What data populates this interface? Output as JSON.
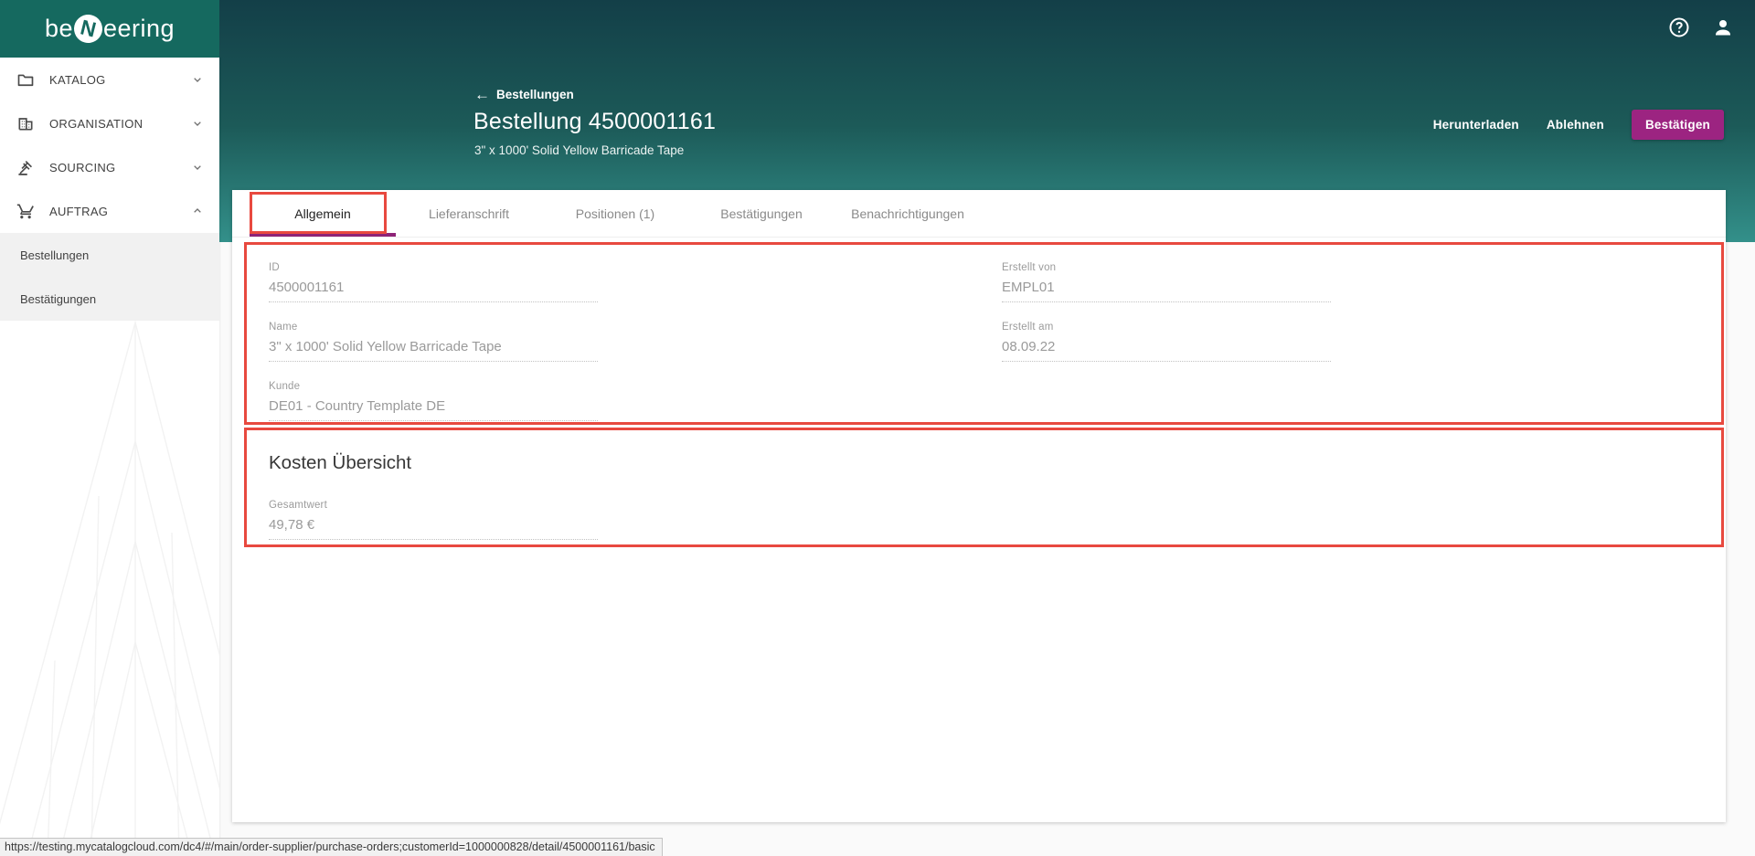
{
  "brand": {
    "prefix": "be",
    "mark": "N",
    "suffix": "eering"
  },
  "topbar": {
    "icons": [
      "help-icon",
      "account-icon"
    ]
  },
  "sidebar": {
    "items": [
      {
        "label": "KATALOG",
        "icon": "folder",
        "expanded": false
      },
      {
        "label": "ORGANISATION",
        "icon": "building",
        "expanded": false
      },
      {
        "label": "SOURCING",
        "icon": "gavel",
        "expanded": false
      },
      {
        "label": "AUFTRAG",
        "icon": "cart",
        "expanded": true
      }
    ],
    "subitems": [
      {
        "label": "Bestellungen",
        "active": true
      },
      {
        "label": "Bestätigungen",
        "active": false
      }
    ]
  },
  "header": {
    "breadcrumb": "Bestellungen",
    "title": "Bestellung 4500001161",
    "subtitle": "3\" x 1000' Solid Yellow Barricade Tape",
    "buttons": [
      {
        "label": "Herunterladen",
        "style": "text"
      },
      {
        "label": "Ablehnen",
        "style": "text"
      },
      {
        "label": "Bestätigen",
        "style": "filled"
      }
    ]
  },
  "tabs": [
    {
      "label": "Allgemein",
      "active": true
    },
    {
      "label": "Lieferanschrift",
      "active": false
    },
    {
      "label": "Positionen (1)",
      "active": false
    },
    {
      "label": "Bestätigungen",
      "active": false
    },
    {
      "label": "Benachrichtigungen",
      "active": false
    }
  ],
  "form": {
    "left": [
      {
        "label": "ID",
        "value": "4500001161"
      },
      {
        "label": "Name",
        "value": "3\" x 1000' Solid Yellow Barricade Tape"
      },
      {
        "label": "Kunde",
        "value": "DE01 - Country Template DE"
      }
    ],
    "right": [
      {
        "label": "Erstellt von",
        "value": "EMPL01"
      },
      {
        "label": "Erstellt am",
        "value": "08.09.22"
      }
    ]
  },
  "cost": {
    "title": "Kosten Übersicht",
    "fields": [
      {
        "label": "Gesamtwert",
        "value": "49,78 €"
      }
    ]
  },
  "statusbar": {
    "url": "https://testing.mycatalogcloud.com/dc4/#/main/order-supplier/purchase-orders;customerId=1000000828/detail/4500001161/basic"
  },
  "colors": {
    "teal_top": "#133f48",
    "teal_bottom": "#33908a",
    "brand_bar": "#15695f",
    "accent_button": "#9c2481",
    "tab_indicator": "#8e2377",
    "annotation_red": "#e8493f"
  }
}
